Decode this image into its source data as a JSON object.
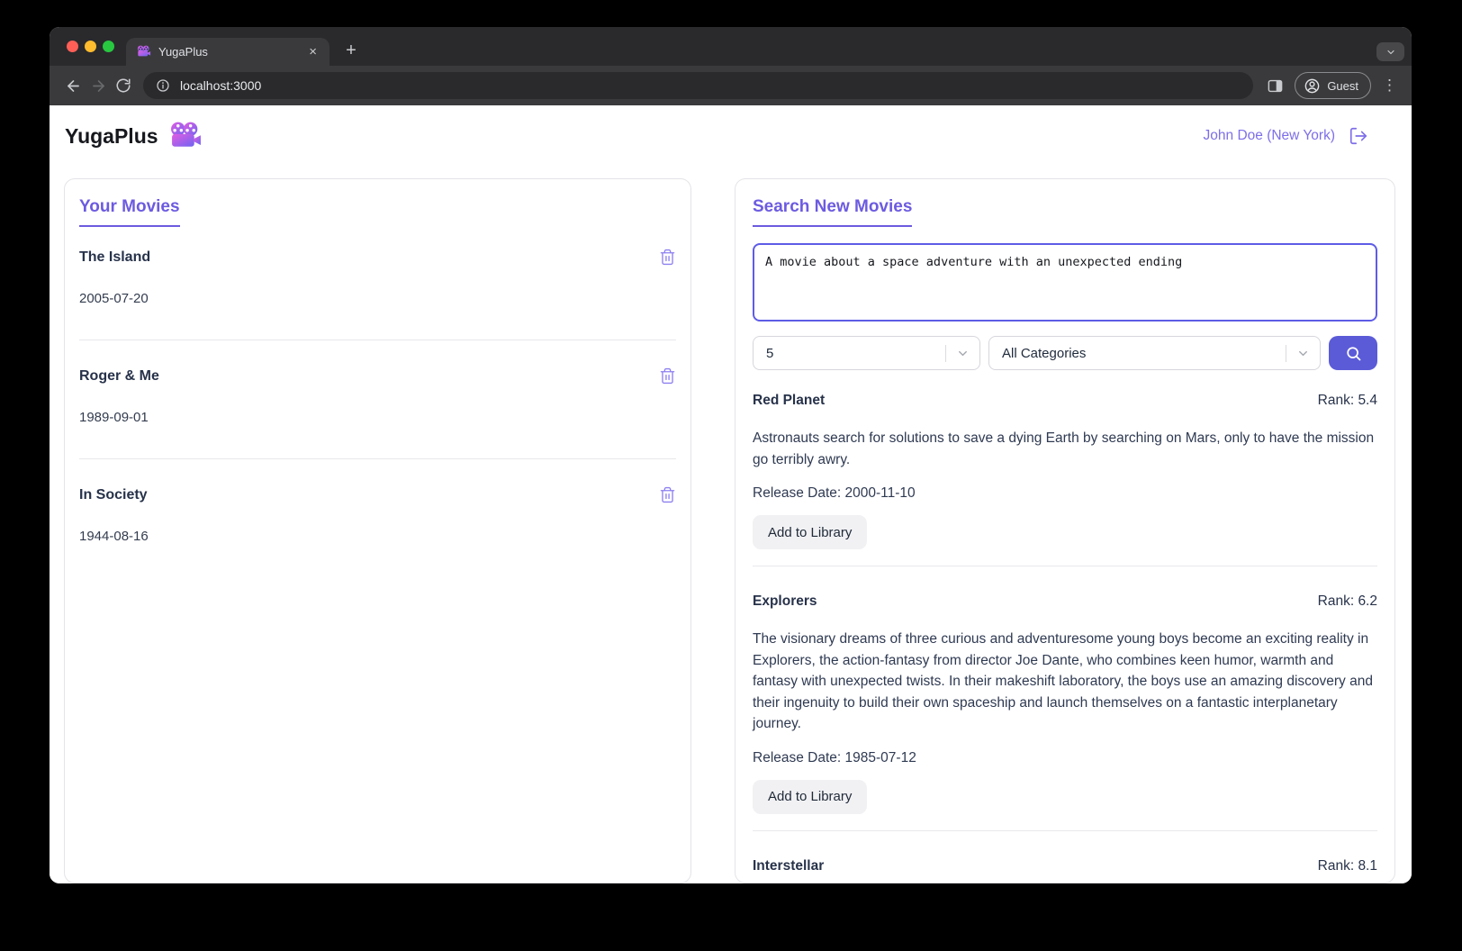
{
  "browser": {
    "tab": {
      "title": "YugaPlus"
    },
    "url": "localhost:3000",
    "profile_label": "Guest",
    "icons": {
      "new_tab": "+",
      "tab_close": "×",
      "menu_dots": "⋮"
    }
  },
  "header": {
    "brand": "YugaPlus",
    "user": "John Doe (New York)"
  },
  "library": {
    "title": "Your Movies",
    "movies": [
      {
        "title": "The Island",
        "date": "2005-07-20"
      },
      {
        "title": "Roger & Me",
        "date": "1989-09-01"
      },
      {
        "title": "In Society",
        "date": "1944-08-16"
      }
    ]
  },
  "search": {
    "title": "Search New Movies",
    "query": "A movie about a space adventure with an unexpected ending",
    "limit": "5",
    "category": "All Categories",
    "results": [
      {
        "title": "Red Planet",
        "rank": "Rank: 5.4",
        "description": "Astronauts search for solutions to save a dying Earth by searching on Mars, only to have the mission go terribly awry.",
        "release": "Release Date: 2000-11-10",
        "action": "Add to Library"
      },
      {
        "title": "Explorers",
        "rank": "Rank: 6.2",
        "description": "The visionary dreams of three curious and adventuresome young boys become an exciting reality in Explorers, the action-fantasy from director Joe Dante, who combines keen humor, warmth and fantasy with unexpected twists. In their makeshift laboratory, the boys use an amazing discovery and their ingenuity to build their own spaceship and launch themselves on a fantastic interplanetary journey.",
        "release": "Release Date: 1985-07-12",
        "action": "Add to Library"
      },
      {
        "title": "Interstellar",
        "rank": "Rank: 8.1"
      }
    ]
  },
  "colors": {
    "accent": "#6c5be0",
    "search_button": "#5b5bd8",
    "user_link": "#7d6ee8",
    "tab_strip": "#2a2a2c",
    "toolbar": "#3a3a3c"
  }
}
